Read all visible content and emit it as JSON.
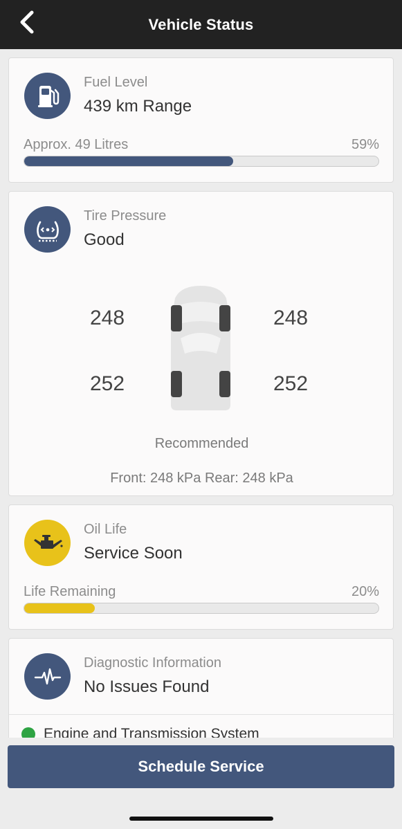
{
  "header": {
    "title": "Vehicle Status",
    "back_icon": "chevron-left-icon"
  },
  "fuel": {
    "label": "Fuel Level",
    "value": "439 km Range",
    "detail": "Approx. 49 Litres",
    "percent_text": "59%",
    "level": 0.59,
    "icon": "fuel-pump-icon",
    "bar_color": "#43577c"
  },
  "tire": {
    "label": "Tire Pressure",
    "value": "Good",
    "front_left": "248",
    "front_right": "248",
    "rear_left": "252",
    "rear_right": "252",
    "recommended_label": "Recommended",
    "recommended_values": "Front: 248 kPa Rear: 248 kPa",
    "icon": "tire-pressure-icon"
  },
  "oil": {
    "label": "Oil Life",
    "value": "Service Soon",
    "detail": "Life Remaining",
    "percent_text": "20%",
    "level": 0.2,
    "icon": "oil-can-icon",
    "bar_color": "#e8c21a"
  },
  "diagnostic": {
    "label": "Diagnostic Information",
    "value": "No Issues Found",
    "first_item": "Engine and Transmission System",
    "icon": "heartbeat-icon"
  },
  "actions": {
    "schedule_label": "Schedule Service"
  },
  "colors": {
    "accent": "#43577c",
    "warning": "#e8c21a",
    "ok": "#2ea343",
    "navbar": "#222222"
  }
}
